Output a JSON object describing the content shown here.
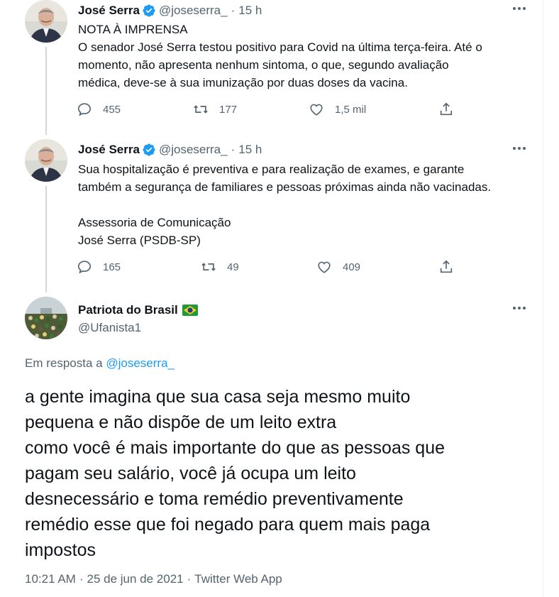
{
  "tweets": [
    {
      "name": "José Serra",
      "handle": "@joseserra_",
      "time": "15 h",
      "lines": [
        "NOTA À IMPRENSA",
        "O senador José Serra testou positivo para Covid na última terça-feira. Até o",
        "momento, não apresenta nenhum sintoma, o que, segundo avaliação",
        "médica, deve-se à sua imunização por duas doses da vacina."
      ],
      "replies": "455",
      "retweets": "177",
      "likes": "1,5 mil"
    },
    {
      "name": "José Serra",
      "handle": "@joseserra_",
      "time": "15 h",
      "lines": [
        "Sua hospitalização é preventiva e para realização de exames, e garante",
        "também a segurança de familiares e pessoas próximas ainda não vacinadas.",
        "",
        "Assessoria de Comunicação",
        "José Serra (PSDB-SP)"
      ],
      "replies": "165",
      "retweets": "49",
      "likes": "409"
    }
  ],
  "reply": {
    "name": "Patriota do Brasil",
    "flag_icon": "brazil-flag-icon",
    "handle": "@Ufanista1",
    "in_reply_prefix": "Em resposta a",
    "in_reply_handle": "@joseserra_",
    "lines": [
      "a gente imagina que sua casa seja mesmo muito",
      "pequena e não dispõe de um leito extra",
      "como você é mais importante do que as pessoas que",
      "pagam seu salário, você já ocupa um leito",
      "desnecessário e toma remédio preventivamente",
      "remédio esse que foi negado para quem mais paga",
      "impostos"
    ],
    "time": "10:21 AM",
    "date": "25 de jun de 2021",
    "source": "Twitter Web App"
  },
  "colors": {
    "accent": "#1d9bf0",
    "secondary_text": "#536471",
    "thread_line": "#cfd9de"
  },
  "separator": "·"
}
